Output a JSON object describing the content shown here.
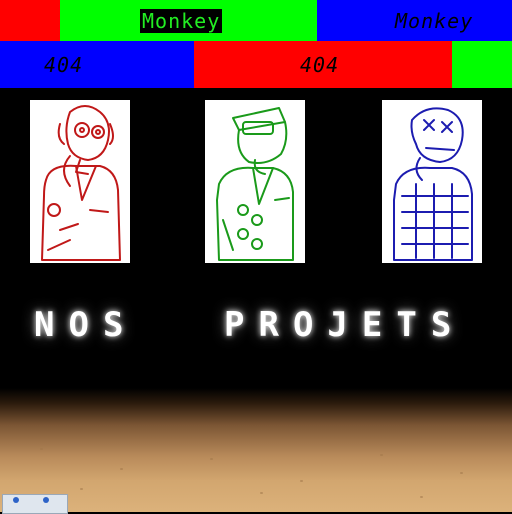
{
  "top_bar": {
    "segments": [
      {
        "label": "",
        "color": "#ff0000"
      },
      {
        "label": "Monkey",
        "color": "#00ff00"
      },
      {
        "label": "Monkey",
        "color": "#0000ff"
      }
    ]
  },
  "second_bar": {
    "segments": [
      {
        "label": "404",
        "color": "#0000ff"
      },
      {
        "label": "404",
        "color": "#ff0000"
      },
      {
        "label": "",
        "color": "#00ff00"
      }
    ]
  },
  "figures": [
    {
      "name": "monkey-red",
      "color": "#c01818"
    },
    {
      "name": "monkey-green",
      "color": "#1a9a1a"
    },
    {
      "name": "monkey-blue",
      "color": "#1c1cb0"
    }
  ],
  "title": {
    "word1": "NOS",
    "word2": "PROJETS"
  }
}
